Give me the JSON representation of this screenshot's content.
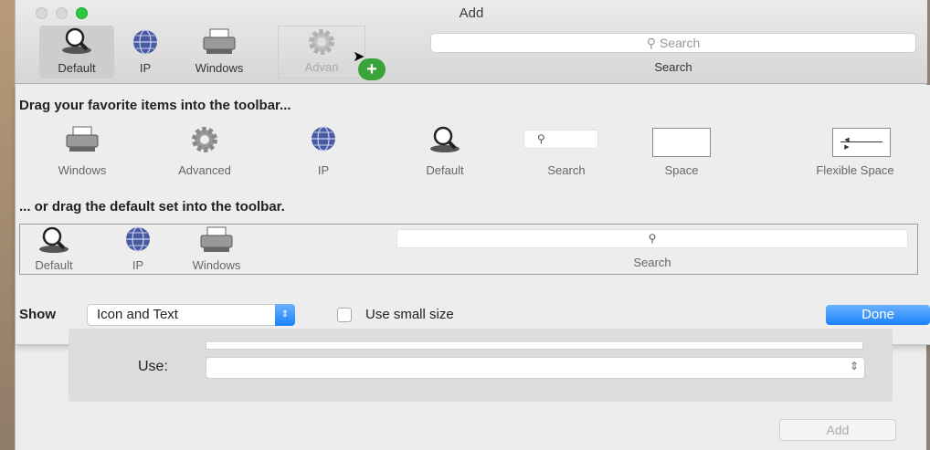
{
  "window": {
    "title": "Add"
  },
  "toolbar": {
    "items": [
      {
        "label": "Default",
        "icon": "magnifier-icon"
      },
      {
        "label": "IP",
        "icon": "globe-icon"
      },
      {
        "label": "Windows",
        "icon": "printer-icon"
      },
      {
        "label": "Advan",
        "icon": "gear-icon"
      }
    ],
    "search_placeholder": "Search",
    "search_label": "Search"
  },
  "customize": {
    "heading": "Drag your favorite items into the toolbar...",
    "palette": [
      {
        "label": "Windows",
        "icon": "printer-icon"
      },
      {
        "label": "Advanced",
        "icon": "gear-icon"
      },
      {
        "label": "IP",
        "icon": "globe-icon"
      },
      {
        "label": "Default",
        "icon": "magnifier-icon"
      },
      {
        "label": "Search",
        "icon": "search-field-icon"
      },
      {
        "label": "Space",
        "icon": "space-icon"
      },
      {
        "label": "Flexible Space",
        "icon": "flexible-space-icon"
      }
    ],
    "default_set_heading": "... or drag the default set into the toolbar.",
    "default_set": [
      {
        "label": "Default",
        "icon": "magnifier-icon"
      },
      {
        "label": "IP",
        "icon": "globe-icon"
      },
      {
        "label": "Windows",
        "icon": "printer-icon"
      },
      {
        "label": "Search",
        "icon": "search-field-icon"
      }
    ],
    "show_label": "Show",
    "show_value": "Icon and Text",
    "small_size_label": "Use small size",
    "small_size_checked": false,
    "done_label": "Done"
  },
  "form": {
    "use_label": "Use:",
    "add_label": "Add"
  },
  "colors": {
    "accent": "#1a82fb",
    "plus": "#3aa43a",
    "close_zoom": "#2bc840"
  }
}
